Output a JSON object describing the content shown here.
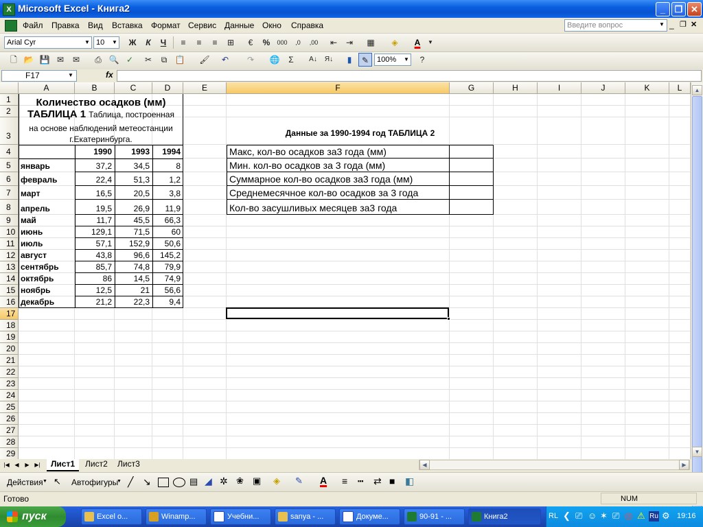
{
  "window": {
    "title": "Microsoft Excel - Книга2"
  },
  "menu": {
    "items": [
      "Файл",
      "Правка",
      "Вид",
      "Вставка",
      "Формат",
      "Сервис",
      "Данные",
      "Окно",
      "Справка"
    ],
    "help_placeholder": "Введите вопрос"
  },
  "format_toolbar": {
    "font": "Arial Cyr",
    "size": "10",
    "bold": "Ж",
    "italic": "К",
    "underline": "Ч",
    "percent": "%",
    "thousands": "000",
    "font_color_letter": "A"
  },
  "standard_toolbar": {
    "zoom": "100%"
  },
  "formula_bar": {
    "cell_ref": "F17",
    "fx": "fx",
    "value": ""
  },
  "columns": [
    "A",
    "B",
    "C",
    "D",
    "E",
    "F",
    "G",
    "H",
    "I",
    "J",
    "K",
    "L"
  ],
  "rows": [
    "1",
    "2",
    "3",
    "4",
    "5",
    "6",
    "7",
    "8",
    "9",
    "10",
    "11",
    "12",
    "13",
    "14",
    "15",
    "16",
    "17",
    "18",
    "19",
    "20",
    "21",
    "22",
    "23",
    "24",
    "25",
    "26",
    "27",
    "28",
    "29"
  ],
  "table1": {
    "title": "Количество осадков (мм)",
    "subtitle_bold": "ТАБЛИЦА 1",
    "subtitle_rest": "Таблица, построенная",
    "subtitle_line2": "на основе наблюдений метеостанции",
    "subtitle_line3": "г.Екатеринбурга.",
    "years": [
      "1990",
      "1993",
      "1994"
    ],
    "months": [
      {
        "name": "январь",
        "v1": "37,2",
        "v2": "34,5",
        "v3": "8"
      },
      {
        "name": "февраль",
        "v1": "22,4",
        "v2": "51,3",
        "v3": "1,2"
      },
      {
        "name": "март",
        "v1": "16,5",
        "v2": "20,5",
        "v3": "3,8"
      },
      {
        "name": "апрель",
        "v1": "19,5",
        "v2": "26,9",
        "v3": "11,9"
      },
      {
        "name": "май",
        "v1": "11,7",
        "v2": "45,5",
        "v3": "66,3"
      },
      {
        "name": "июнь",
        "v1": "129,1",
        "v2": "71,5",
        "v3": "60"
      },
      {
        "name": "июль",
        "v1": "57,1",
        "v2": "152,9",
        "v3": "50,6"
      },
      {
        "name": "август",
        "v1": "43,8",
        "v2": "96,6",
        "v3": "145,2"
      },
      {
        "name": "сентябрь",
        "v1": "85,7",
        "v2": "74,8",
        "v3": "79,9"
      },
      {
        "name": "октябрь",
        "v1": "86",
        "v2": "14,5",
        "v3": "74,9"
      },
      {
        "name": "ноябрь",
        "v1": "12,5",
        "v2": "21",
        "v3": "56,6"
      },
      {
        "name": "декабрь",
        "v1": "21,2",
        "v2": "22,3",
        "v3": "9,4"
      }
    ]
  },
  "table2": {
    "title": "Данные за 1990-1994 год ТАБЛИЦА 2",
    "rows": [
      "Макс, кол-во осадков за3 года (мм)",
      "Мин. кол-во осадков за 3 года (мм)",
      "Суммарное кол-во осадков за3 года (мм)",
      "Среднемесячное кол-во осадков за 3 года",
      "Кол-во засушливых месяцев за3 года"
    ]
  },
  "sheets": [
    "Лист1",
    "Лист2",
    "Лист3"
  ],
  "drawing_toolbar": {
    "actions": "Действия",
    "autoshapes": "Автофигуры"
  },
  "status": {
    "left": "Готово",
    "num": "NUM"
  },
  "taskbar": {
    "start": "пуск",
    "tasks": [
      "Excel o...",
      "Winamp...",
      "Учебни...",
      "sanya - ...",
      "Докуме...",
      "90-91 - ...",
      "Книга2"
    ],
    "lang": "RL",
    "clock": "19:16"
  },
  "colors": {
    "title_blue": "#0a5fe0",
    "selected_header": "#f7c966",
    "taskbar_blue": "#245edb",
    "start_green": "#3a9c3a"
  }
}
